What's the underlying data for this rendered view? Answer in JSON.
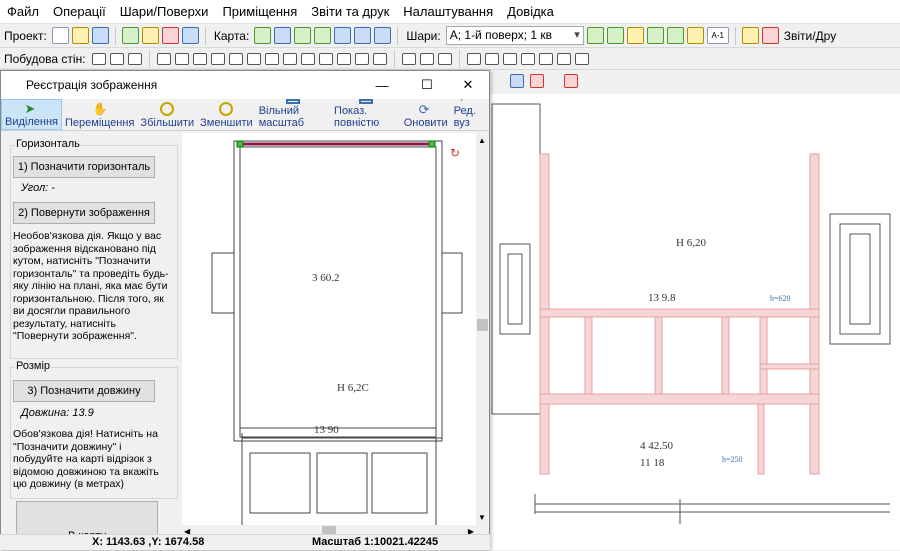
{
  "menu": [
    "Файл",
    "Операції",
    "Шари/Поверхи",
    "Приміщення",
    "Звіти та друк",
    "Налаштування",
    "Довідка"
  ],
  "toolbar": {
    "project_label": "Проект:",
    "map_label": "Карта:",
    "layers_label": "Шари:",
    "layers_value": "A; 1-й поверх; 1 кв",
    "reports_label": "Звіти/Дру",
    "walls_label": "Побудова стін:",
    "icon_badge": "A-1"
  },
  "dialog": {
    "title": "Реєстрація зображення",
    "tools": [
      "Виділення",
      "Переміщення",
      "Збільшити",
      "Зменшити",
      "Вільний масштаб",
      "Показ. повністю",
      "Оновити",
      "Ред. вуз"
    ],
    "horizon": {
      "group": "Горизонталь",
      "mark_button": "1) Позначити горизонталь",
      "angle": "Угол: -",
      "rotate_button": "2) Повернути зображення",
      "note": "Необов'язкова дія. Якщо у вас зображення відскановано під кутом, натисніть \"Позначити горизонталь\" та проведіть будь-яку лінію на плані, яка має бути горизонтальною. Після того, як ви досягли правильного результату, натисніть \"Повернути зображення\"."
    },
    "size": {
      "group": "Розмір",
      "mark_button": "3) Позначити довжину",
      "length": "Довжина: 13.9",
      "note": "Обов'язкова дія! Натисніть на \"Позначити довжину\" і побудуйте на карті відрізок з відомою довжиною та вкажіть цю довжину (в метрах)"
    },
    "to_map_button": "В карту",
    "coords": "X: 1143.63 ,Y: 1674.58",
    "scale": "Масштаб 1:10021.42245"
  },
  "plan_labels": {
    "left_area": "3\n60.2",
    "left_height": "H 6,2C",
    "left_dim": "13 90",
    "right_height": "H 6,20",
    "right_dim": "13 9.8",
    "h620": "h=620",
    "h250": "h=250",
    "right_big": "4 42.50",
    "right_small": "11 18"
  },
  "colors": {
    "accent": "#0078d7",
    "wall": "#e9a0a0",
    "measure_line": "#8b1a4a"
  }
}
